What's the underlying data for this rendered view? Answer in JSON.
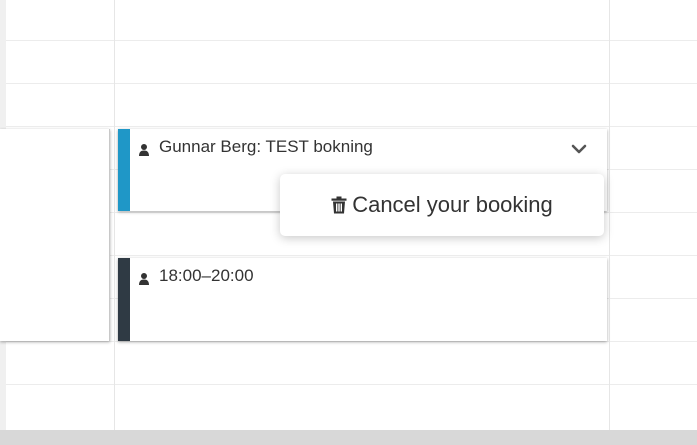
{
  "events": [
    {
      "title": "Gunnar Berg: TEST bokning",
      "stripe_color": "#1f97c7",
      "icon": "person-icon",
      "menu_icon": "chevron-down-icon"
    },
    {
      "title": "18:00–20:00",
      "stripe_color": "#2f3a44",
      "icon": "person-icon"
    }
  ],
  "dropdown": {
    "items": [
      {
        "label": "Cancel your booking",
        "icon": "trash-icon"
      }
    ]
  }
}
